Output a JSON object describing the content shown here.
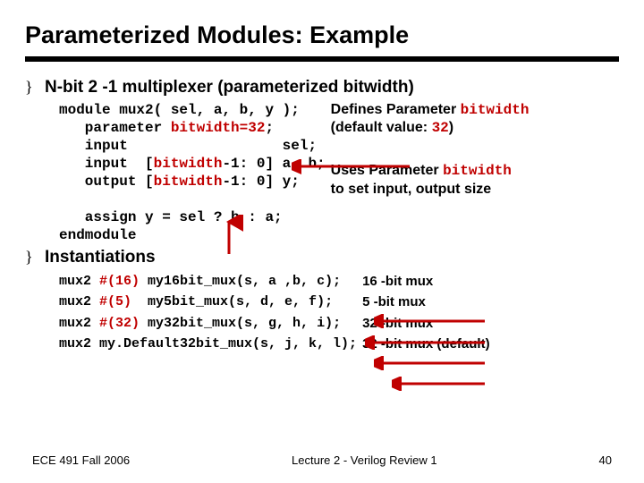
{
  "title": "Parameterized Modules: Example",
  "section1": {
    "bullet": "N-bit 2 -1 multiplexer (parameterized bitwidth)",
    "code": {
      "l1a": "module mux2( sel, a, b, y );",
      "l2a": "   parameter ",
      "l2b": "bitwidth=32",
      "l2c": ";",
      "l3a": "   input                  sel;",
      "l4a": "   input  [",
      "l4b": "bitwidth",
      "l4c": "-1: 0] a, b;",
      "l5a": "   output [",
      "l5b": "bitwidth",
      "l5c": "-1: 0] y;",
      "l6": "",
      "l7a": "   assign y = sel ? b : a;",
      "l8a": "endmodule"
    },
    "note1a": "Defines Parameter ",
    "note1b": "bitwidth",
    "note1c": "(default value: ",
    "note1d": "32",
    "note1e": ")",
    "note2a": "Uses Parameter ",
    "note2b": "bitwidth",
    "note2c": "to set input, output size"
  },
  "section2": {
    "bullet": "Instantiations",
    "inst": {
      "l1a": "mux2 ",
      "l1b": "#(16)",
      "l1c": " my16bit_mux(s, a ,b, c);",
      "l2a": "mux2 ",
      "l2b": "#(5) ",
      "l2c": " my5bit_mux(s, d, e, f);",
      "l3a": "mux2 ",
      "l3b": "#(32)",
      "l3c": " my32bit_mux(s, g, h, i);",
      "l4a": "mux2 my.Default32bit_mux(s, j, k, l);"
    },
    "notes": {
      "n1": "16 -bit mux",
      "n2": "5 -bit mux",
      "n3": "32 -bit mux",
      "n4": "32 -bit mux (default)"
    }
  },
  "footer": {
    "left": "ECE 491 Fall 2006",
    "center": "Lecture 2 - Verilog Review 1",
    "right": "40"
  }
}
